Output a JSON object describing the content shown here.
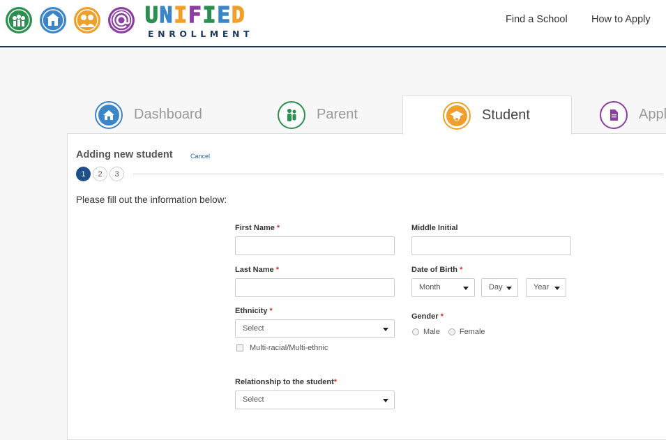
{
  "header": {
    "logo_word": [
      "U",
      "N",
      "I",
      "F",
      "I",
      "E",
      "D"
    ],
    "logo_word_colors": [
      "#2a8f4f",
      "#3a86c8",
      "#f0a02a",
      "#8b3fa0",
      "#2a8f4f",
      "#3a86c8",
      "#f0a02a"
    ],
    "logo_sub": "ENROLLMENT",
    "nav": [
      {
        "label": "Find a School"
      },
      {
        "label": "How to Apply"
      }
    ]
  },
  "tabs": [
    {
      "label": "Dashboard",
      "icon": "home-icon",
      "color": "#3a86c8"
    },
    {
      "label": "Parent",
      "icon": "parent-icon",
      "color": "#2a8f4f"
    },
    {
      "label": "Student",
      "icon": "graduation-cap-icon",
      "color": "#f0a02a",
      "active": true
    },
    {
      "label": "Appl",
      "icon": "document-icon",
      "color": "#8b3fa0"
    }
  ],
  "form": {
    "title": "Adding new student",
    "cancel_label": "Cancel",
    "steps": [
      "1",
      "2",
      "3"
    ],
    "instructions": "Please fill out the information below:",
    "first_name_label": "First Name",
    "middle_initial_label": "Middle Initial",
    "last_name_label": "Last Name",
    "dob_label": "Date of Birth",
    "dob_month": "Month",
    "dob_day": "Day",
    "dob_year": "Year",
    "ethnicity_label": "Ethnicity",
    "ethnicity_value": "Select",
    "multiracial_label": "Multi-racial/Multi-ethnic",
    "gender_label": "Gender",
    "gender_male": "Male",
    "gender_female": "Female",
    "relationship_label": "Relationship to the student",
    "relationship_value": "Select",
    "required_mark": "*"
  },
  "colors": {
    "accent_blue": "#1f4f8a",
    "required_red": "#c9302c",
    "header_border": "#1f3a5f"
  }
}
